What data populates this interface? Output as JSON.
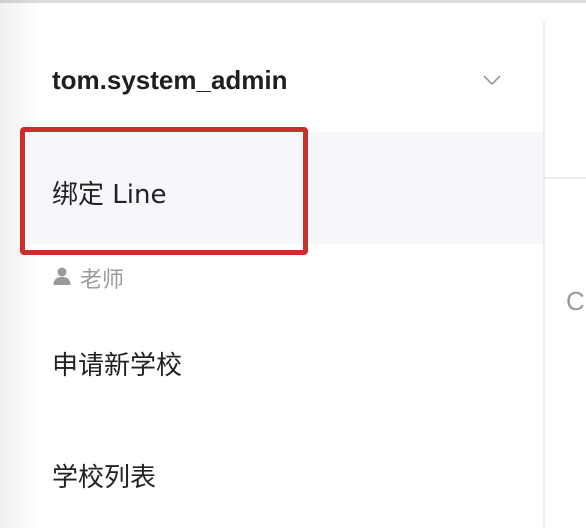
{
  "account": {
    "username": "tom.system_admin",
    "expand_icon": "chevron-down-icon"
  },
  "menu": {
    "bind_line_label": "绑定 Line",
    "role_icon": "user-icon",
    "role_label": "老师",
    "items": [
      {
        "label": "申请新学校"
      },
      {
        "label": "学校列表"
      }
    ]
  },
  "right_panel": {
    "peek_text": "C"
  },
  "colors": {
    "highlight_border": "#c9302c",
    "selected_background": "#f6f7fb",
    "muted_text": "#9a9a9a",
    "primary_text": "#222222"
  }
}
